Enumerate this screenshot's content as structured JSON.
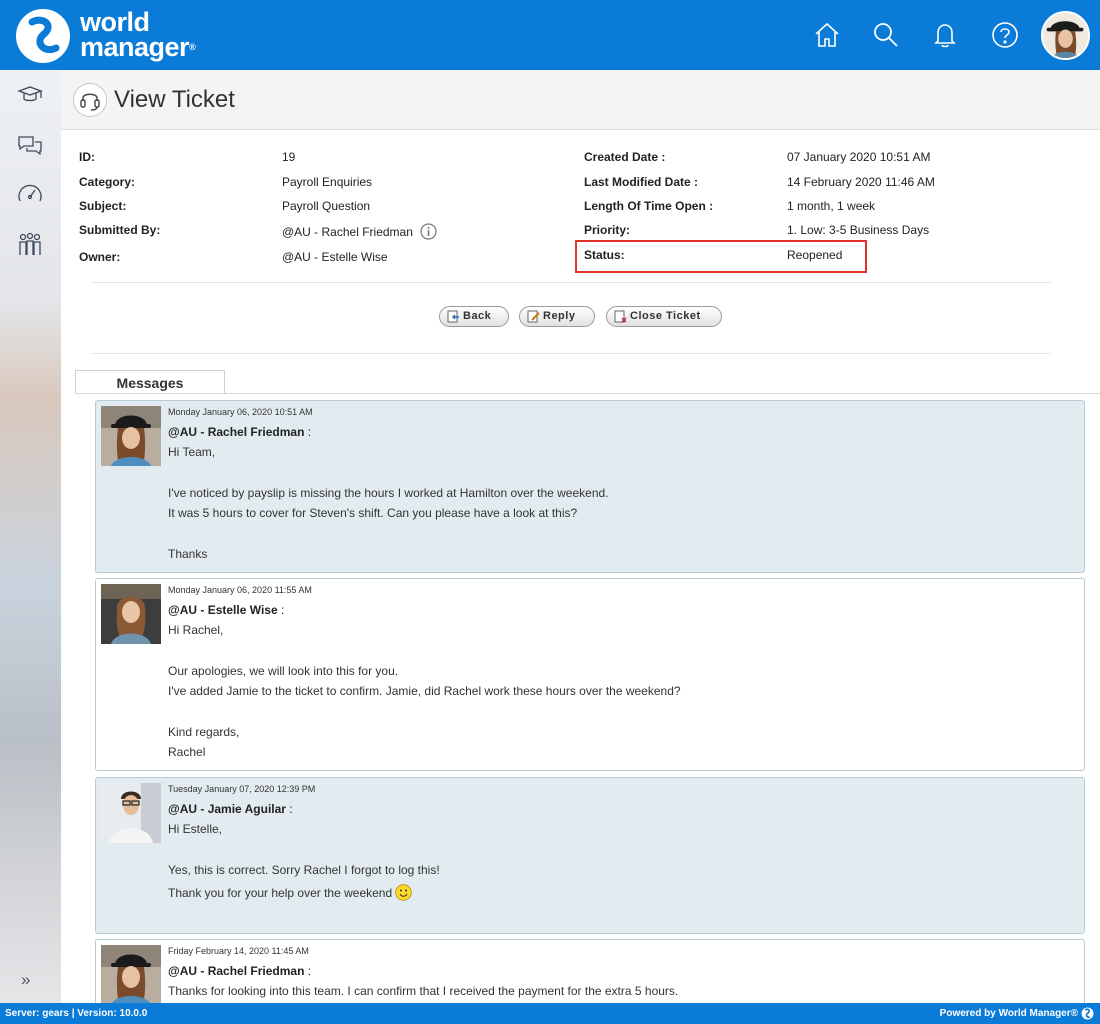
{
  "brand": {
    "line1": "world",
    "line2": "manager",
    "reg": "®"
  },
  "header": {
    "icons": [
      "home-icon",
      "search-icon",
      "bell-icon",
      "help-icon"
    ]
  },
  "sidebar": {
    "icons": [
      "training-icon",
      "chat-icon",
      "dashboard-icon",
      "people-icon"
    ],
    "expand": "»"
  },
  "page": {
    "title": "View Ticket"
  },
  "ticket": {
    "id_label": "ID:",
    "id": "19",
    "category_label": "Category:",
    "category": "Payroll Enquiries",
    "subject_label": "Subject:",
    "subject": "Payroll Question",
    "submitted_label": "Submitted By:",
    "submitted_by": "@AU - Rachel Friedman",
    "owner_label": "Owner:",
    "owner": "@AU - Estelle Wise",
    "created_label": "Created Date :",
    "created": "07 January 2020 10:51 AM",
    "modified_label": "Last Modified Date :",
    "modified": "14 February 2020 11:46 AM",
    "open_label": "Length Of Time Open :",
    "open": "1 month, 1 week",
    "priority_label": "Priority:",
    "priority": "1. Low: 3-5 Business Days",
    "status_label": "Status:",
    "status": "Reopened"
  },
  "buttons": {
    "back": "Back",
    "reply": "Reply",
    "close": "Close Ticket"
  },
  "messages_tab": "Messages",
  "messages": [
    {
      "date": "Monday January 06, 2020 10:51 AM",
      "author": "@AU - Rachel Friedman",
      "lines": [
        "Hi Team,",
        "I've noticed by payslip is missing the hours I worked at Hamilton over the weekend.",
        "It was 5 hours to cover for Steven's shift. Can you please have a look at this?",
        "Thanks"
      ]
    },
    {
      "date": "Monday January 06, 2020 11:55 AM",
      "author": "@AU - Estelle Wise",
      "lines": [
        "Hi Rachel,",
        "Our apologies, we will look into this for you.",
        "I've added Jamie to the ticket to confirm. Jamie, did Rachel work these hours over the weekend?",
        "Kind regards,",
        "Rachel"
      ]
    },
    {
      "date": "Tuesday January 07, 2020 12:39 PM",
      "author": "@AU - Jamie Aguilar",
      "lines": [
        "Hi Estelle,",
        "Yes, this is correct. Sorry Rachel I forgot to log this!",
        "Thank you for your help over the weekend"
      ]
    },
    {
      "date": "Friday February 14, 2020 11:45 AM",
      "author": "@AU - Rachel Friedman",
      "lines": [
        "Thanks for looking into this team. I can confirm that I received the payment for the extra 5 hours."
      ]
    }
  ],
  "footer": {
    "left": "Server: gears  |  Version: 10.0.0",
    "right": "Powered by World Manager®"
  },
  "colors": {
    "brand_blue": "#0a7bd6",
    "highlight_red": "#e2332b",
    "message_shade": "#e2ebf0"
  }
}
